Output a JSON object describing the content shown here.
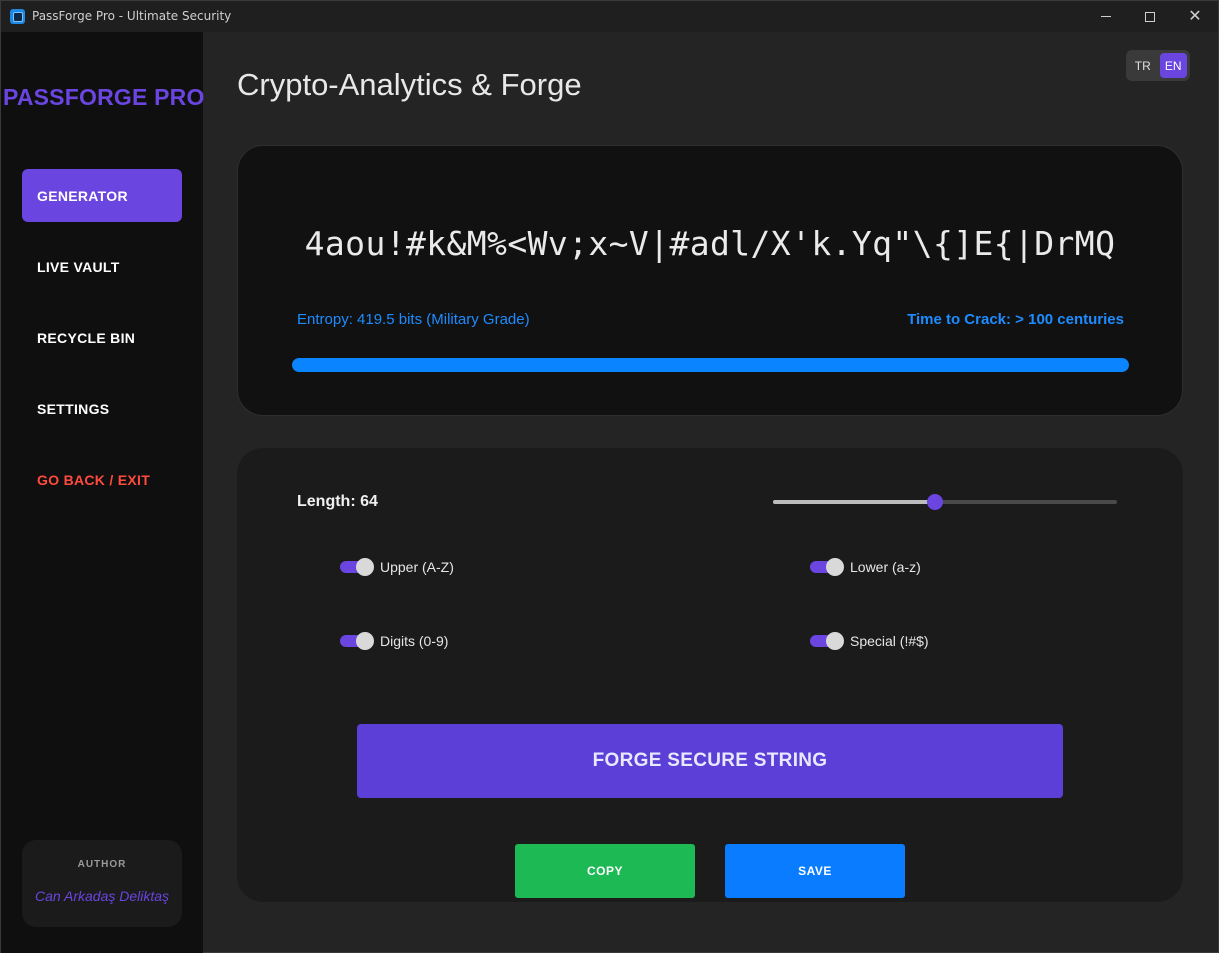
{
  "window": {
    "title": "PassForge Pro - Ultimate Security",
    "app_icon": "shield-app-icon"
  },
  "sidebar": {
    "brand": "PASSFORGE PRO",
    "items": [
      {
        "label": "GENERATOR",
        "active": true
      },
      {
        "label": "LIVE VAULT",
        "active": false
      },
      {
        "label": "RECYCLE BIN",
        "active": false
      },
      {
        "label": "SETTINGS",
        "active": false
      },
      {
        "label": "GO BACK / EXIT",
        "active": false
      }
    ],
    "author": {
      "title": "AUTHOR",
      "name": "Can Arkadaş Deliktaş"
    }
  },
  "header": {
    "title": "Crypto-Analytics & Forge",
    "languages": [
      "TR",
      "EN"
    ],
    "selected_language": "EN"
  },
  "password_card": {
    "password": "4aou!#k&M%<Wv;x~V|#adl/X'k.Yq\"\\{]E{|DrMQ",
    "entropy": "Entropy: 419.5 bits (Military Grade)",
    "crack_time": "Time to Crack: > 100 centuries",
    "strength_percent": 100
  },
  "options": {
    "length_label": "Length: 64",
    "length_value": 64,
    "slider_fraction": 0.47,
    "toggles": [
      {
        "label": "Upper (A-Z)",
        "on": true
      },
      {
        "label": "Lower (a-z)",
        "on": true
      },
      {
        "label": "Digits (0-9)",
        "on": true
      },
      {
        "label": "Special (!#$)",
        "on": true
      }
    ],
    "forge_label": "FORGE SECURE STRING",
    "copy_label": "COPY",
    "save_label": "SAVE"
  },
  "colors": {
    "accent": "#6a45e0",
    "info": "#1e8cff",
    "copy": "#1db954",
    "save": "#0a7cff",
    "exit": "#ff4b3e"
  }
}
